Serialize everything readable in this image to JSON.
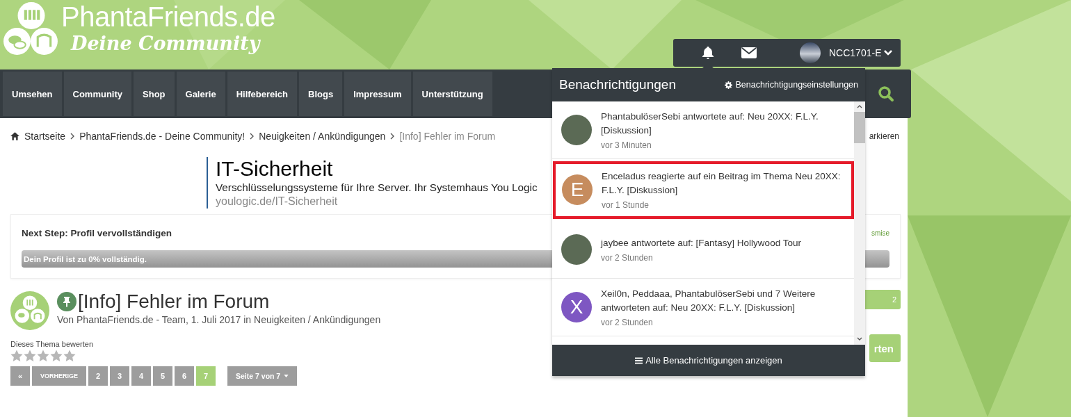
{
  "header": {
    "site_name": "PhantaFriends.de",
    "tagline": "Deine Community"
  },
  "user_bar": {
    "username": "NCC1701-E"
  },
  "nav": {
    "items": [
      {
        "label": "Umsehen"
      },
      {
        "label": "Community"
      },
      {
        "label": "Shop"
      },
      {
        "label": "Galerie"
      },
      {
        "label": "Hilfebereich"
      },
      {
        "label": "Blogs"
      },
      {
        "label": "Impressum"
      },
      {
        "label": "Unterstützung"
      }
    ]
  },
  "breadcrumb": {
    "items": [
      "Startseite",
      "PhantaFriends.de - Deine Community!",
      "Neuigkeiten / Ankündigungen"
    ],
    "current": "[Info] Fehler im Forum",
    "side_text": "arkieren"
  },
  "ad": {
    "title": "IT-Sicherheit",
    "text": "Verschlüsselungssysteme für Ihre Server. Ihr Systemhaus You Logic",
    "url": "youlogic.de/IT-Sicherheit"
  },
  "profile_step": {
    "title": "Next Step: Profil vervollständigen",
    "side_text": "smise",
    "progress_label": "Dein Profil ist zu 0% vollständig.",
    "level": 0
  },
  "thread": {
    "title": "[Info] Fehler im Forum",
    "pinned": true,
    "byline": "Von PhantaFriends.de - Team, 1. Juli 2017 in Neuigkeiten / Ankündigungen",
    "side_badge": "2"
  },
  "rating": {
    "label": "Dieses Thema bewerten",
    "stars": 0,
    "side_button": "rten"
  },
  "pagination": {
    "first": "«",
    "previous": "VORHERIGE",
    "pages": [
      {
        "label": "2",
        "selected": false
      },
      {
        "label": "3",
        "selected": false
      },
      {
        "label": "4",
        "selected": false
      },
      {
        "label": "5",
        "selected": false
      },
      {
        "label": "6",
        "selected": false
      },
      {
        "label": "7",
        "selected": true
      }
    ],
    "jump": "Seite 7 von 7"
  },
  "notifications": {
    "title": "Benachrichtigungen",
    "settings_label": "Benachrichtigungseinstellungen",
    "footer": "Alle Benachrichtigungen anzeigen",
    "items": [
      {
        "kind": "photo",
        "text": "PhantabulöserSebi antwortete auf: Neu 20XX: F.L.Y. [Diskussion]",
        "time": "vor 3 Minuten",
        "highlighted": false
      },
      {
        "kind": "letter",
        "letter": "E",
        "color": "#c68c5e",
        "text": "Enceladus reagierte auf ein Beitrag im Thema Neu 20XX: F.L.Y. [Diskussion]",
        "time": "vor 1 Stunde",
        "highlighted": true
      },
      {
        "kind": "photo",
        "text": "jaybee antwortete auf: [Fantasy] Hollywood Tour",
        "time": "vor 2 Stunden",
        "highlighted": false
      },
      {
        "kind": "letter",
        "letter": "X",
        "color": "#7e57c2",
        "text": "Xeil0n, Peddaaa, PhantabulöserSebi und 7 Weitere antworteten auf: Neu 20XX: F.L.Y. [Diskussion]",
        "time": "vor 2 Stunden",
        "highlighted": false
      }
    ]
  }
}
